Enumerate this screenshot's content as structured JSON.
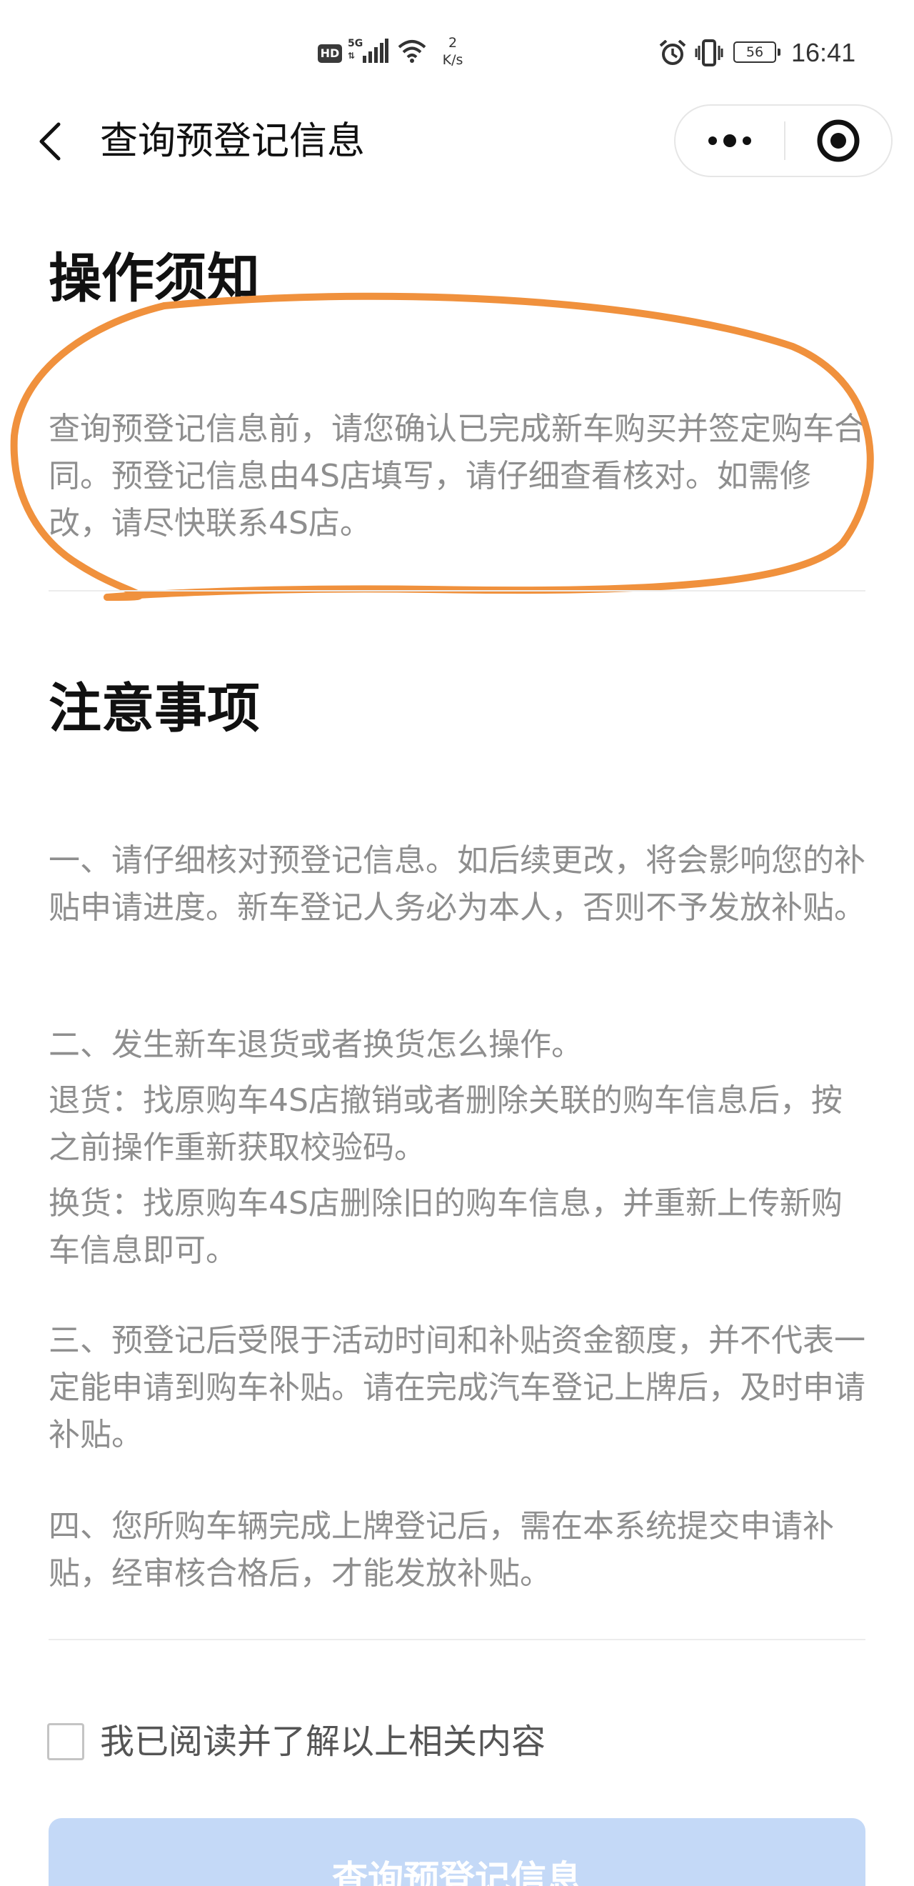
{
  "status_bar": {
    "hd": "HD",
    "network_top": "5G",
    "network_bottom": "⇅",
    "speed_value": "2",
    "speed_unit": "K/s",
    "battery": "56",
    "time": "16:41"
  },
  "nav": {
    "title": "查询预登记信息"
  },
  "notice": {
    "title": "操作须知",
    "body": "查询预登记信息前，请您确认已完成新车购买并签定购车合同。预登记信息由4S店填写，请仔细查看核对。如需修改，请尽快联系4S店。",
    "annotation_color": "#f0913d"
  },
  "precautions": {
    "title": "注意事项",
    "item1": "一、请仔细核对预登记信息。如后续更改，将会影响您的补贴申请进度。新车登记人务必为本人，否则不予发放补贴。",
    "item2_heading": "二、发生新车退货或者换货怎么操作。",
    "item2_return": "退货：找原购车4S店撤销或者删除关联的购车信息后，按之前操作重新获取校验码。",
    "item2_exchange": "换货：找原购车4S店删除旧的购车信息，并重新上传新购车信息即可。",
    "item3": "三、预登记后受限于活动时间和补贴资金额度，并不代表一定能申请到购车补贴。请在完成汽车登记上牌后，及时申请补贴。",
    "item4": "四、您所购车辆完成上牌登记后，需在本系统提交申请补贴，经审核合格后，才能发放补贴。"
  },
  "agreement": {
    "label": "我已阅读并了解以上相关内容"
  },
  "submit": {
    "label": "查询预登记信息",
    "color": "#c4d9f7"
  }
}
